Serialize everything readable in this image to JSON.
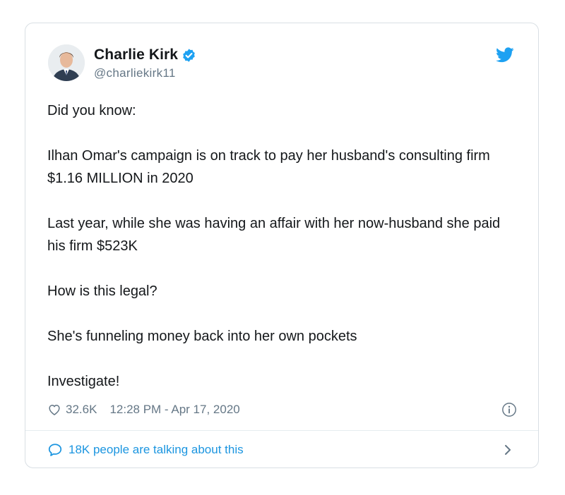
{
  "tweet": {
    "author_name": "Charlie Kirk",
    "handle": "@charliekirk11",
    "paragraphs": [
      "Did you know:",
      "Ilhan Omar's campaign is on track to pay her husband's consulting firm $1.16 MILLION in 2020",
      "Last year, while she was having an affair with her now-husband she paid his firm $523K",
      "How is this legal?",
      "She's funneling money back into her own pockets",
      "Investigate!"
    ],
    "likes": "32.6K",
    "timestamp": "12:28 PM - Apr 17, 2020",
    "talking": "18K people are talking about this"
  },
  "colors": {
    "accent": "#1da1f2",
    "link": "#1b95e0",
    "muted": "#657786",
    "text": "#14171a"
  },
  "icons": [
    "verified-badge-icon",
    "twitter-bird-icon",
    "heart-icon",
    "info-icon",
    "speech-bubble-icon",
    "chevron-right-icon"
  ]
}
